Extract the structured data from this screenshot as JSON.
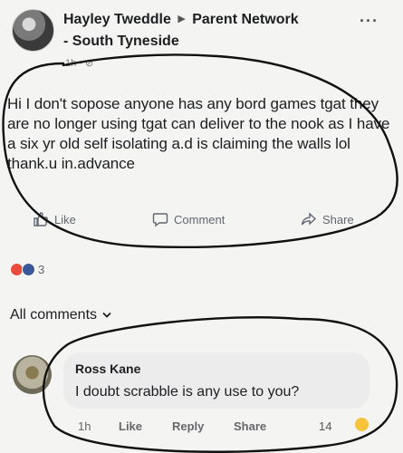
{
  "post": {
    "author": "Hayley Tweddle",
    "group": "Parent Network",
    "group_line2": "- South Tyneside",
    "meta": "1h · ⊘",
    "text": "Hi I don't sopose anyone has any bord games tgat they are no longer using tgat can deliver to the nook as I have a six yr old self isolating a.d is claiming the walls lol  thank.u in.advance",
    "more": "···",
    "arrow": "▶"
  },
  "actions": {
    "like": "Like",
    "comment": "Comment",
    "share": "Share"
  },
  "reactions": {
    "count": "3",
    "colors": [
      "#e94b3c",
      "#3b5998"
    ]
  },
  "comments_header": "All comments",
  "comment": {
    "author": "Ross Kane",
    "text": "I doubt scrabble is any use to you?",
    "time": "1h",
    "like": "Like",
    "reply": "Reply",
    "share": "Share",
    "reaction_count": "14"
  },
  "colors": {
    "pen": "#111111",
    "muted": "#606770"
  }
}
